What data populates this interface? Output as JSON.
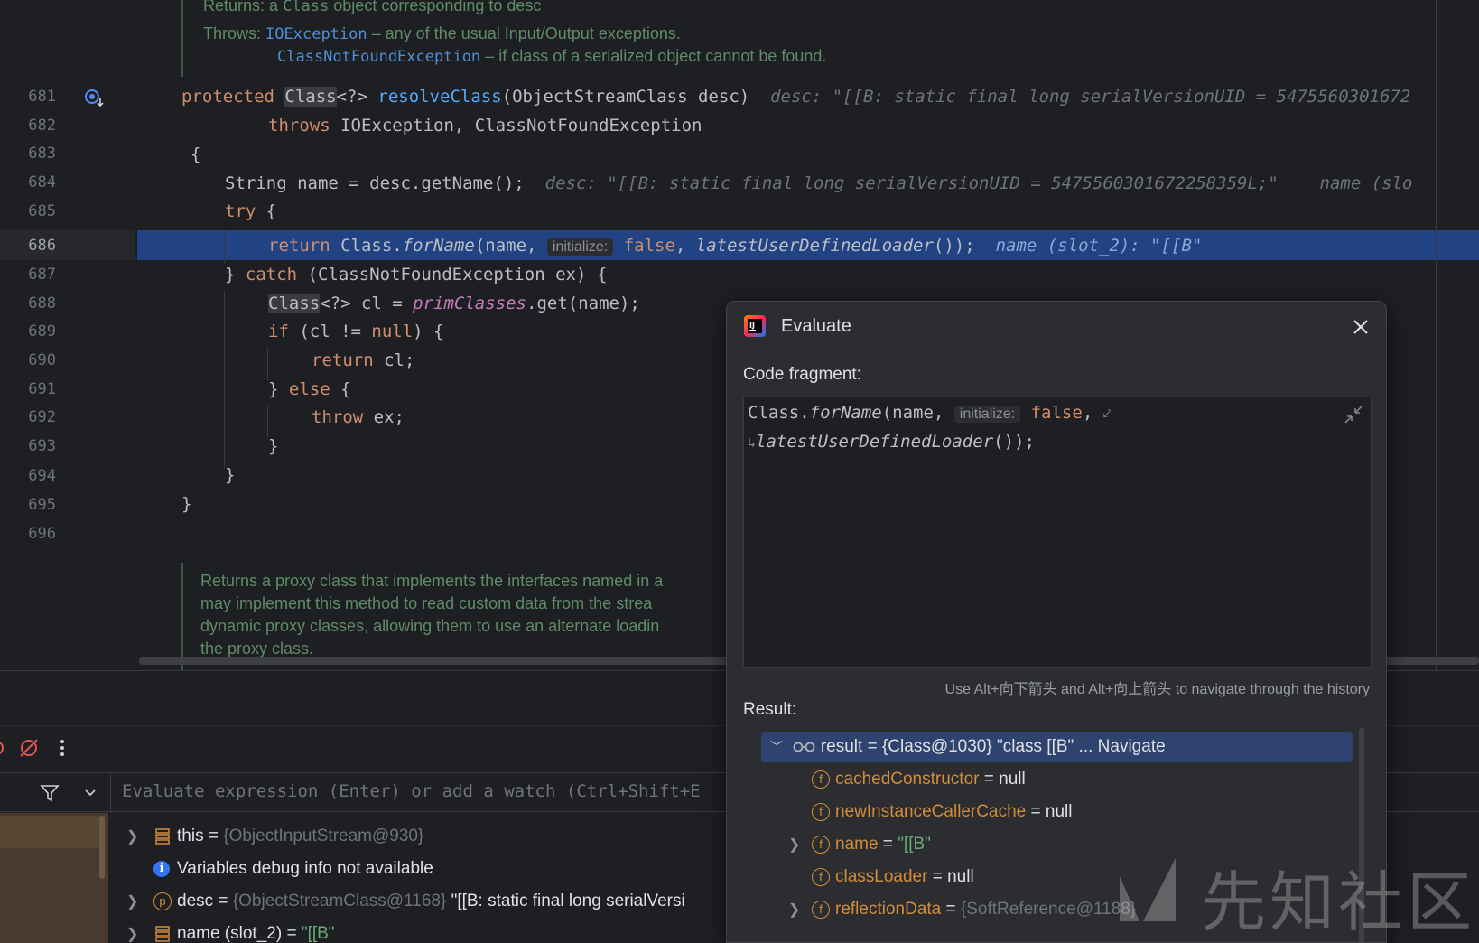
{
  "editor": {
    "doc_top": {
      "returns_label": "Returns:",
      "returns_text": "a",
      "returns_class": "Class",
      "returns_rest": "object corresponding to desc",
      "throws_label": "Throws:",
      "exc1": "IOException",
      "exc1_text": "– any of the usual Input/Output exceptions.",
      "exc2": "ClassNotFoundException",
      "exc2_text": "– if class of a serialized object cannot be found."
    },
    "line_numbers": [
      "681",
      "682",
      "683",
      "684",
      "685",
      "686",
      "687",
      "688",
      "689",
      "690",
      "691",
      "692",
      "693",
      "694",
      "695",
      "696"
    ],
    "lines": {
      "l681_kw": "protected",
      "l681_type": "Class",
      "l681_gen": "<?> ",
      "l681_fn": "resolveClass",
      "l681_rest": "(ObjectStreamClass desc)",
      "l681_hint": "desc: \"[[B: static final long serialVersionUID = 5475560301672",
      "l682_kw": "throws",
      "l682_rest": " IOException, ClassNotFoundException",
      "l683": "{",
      "l684_code": "String name = desc.getName();",
      "l684_hint": "desc: \"[[B: static final long serialVersionUID = 5475560301672258359L;\"    name (slo",
      "l685_kw": "try",
      "l685_rest": " {",
      "l686_kw": "return",
      "l686_cls": "Class.",
      "l686_fn": "forName",
      "l686_a": "(name, ",
      "l686_inlay": "initialize:",
      "l686_false": "false",
      "l686_b": ", ",
      "l686_fn2": "latestUserDefinedLoader",
      "l686_c": "());",
      "l686_hint": "name (slot_2): \"[[B\"",
      "l687_a": "} ",
      "l687_kw": "catch",
      "l687_rest": " (ClassNotFoundException ex) {",
      "l688_type": "Class",
      "l688_a": "<?> cl = ",
      "l688_field": "primClasses",
      "l688_rest": ".get(name);",
      "l689_kw": "if",
      "l689_a": " (cl != ",
      "l689_null": "null",
      "l689_rest": ") {",
      "l690_kw": "return",
      "l690_rest": " cl;",
      "l691_a": "} ",
      "l691_kw": "else",
      "l691_rest": " {",
      "l692_kw": "throw",
      "l692_rest": " ex;",
      "l693": "}",
      "l694": "}",
      "l695": "}"
    },
    "doc_bottom": [
      "Returns a proxy class that implements the interfaces named in a",
      "may implement this method to read custom data from the strea",
      "dynamic proxy classes, allowing them to use an alternate loadin",
      "the proxy class."
    ]
  },
  "debug": {
    "watch_placeholder": "Evaluate expression (Enter) or add a watch (Ctrl+Shift+E",
    "variables": [
      {
        "name": "this",
        "eq": " = ",
        "value": "{ObjectInputStream@930}"
      },
      {
        "info": "Variables debug info not available"
      },
      {
        "name": "desc",
        "eq": " = ",
        "value": "{ObjectStreamClass@1168}",
        "extra": " \"[[B: static final long serialVersi"
      },
      {
        "name": "name (slot_2)",
        "eq": " = ",
        "value": "\"[[B\""
      }
    ]
  },
  "dialog": {
    "title": "Evaluate",
    "code_label": "Code fragment:",
    "code_line1_a": "Class.",
    "code_line1_fn": "forName",
    "code_line1_b": "(name, ",
    "code_line1_inlay": "initialize:",
    "code_line1_false": "false",
    "code_line1_c": ",",
    "code_line2": "latestUserDefinedLoader",
    "code_line2_end": "());",
    "history_hint": "Use Alt+向下箭头 and Alt+向上箭头 to navigate through the history",
    "result_label": "Result:",
    "result_root": "result = {Class@1030} \"class [[B\" ... Navigate",
    "fields": [
      {
        "name": "cachedConstructor",
        "eq": " = ",
        "value": "null",
        "expandable": false
      },
      {
        "name": "newInstanceCallerCache",
        "eq": " = ",
        "value": "null",
        "expandable": false
      },
      {
        "name": "name",
        "eq": " = ",
        "value": "\"[[B\"",
        "expandable": true
      },
      {
        "name": "classLoader",
        "eq": " = ",
        "value": "null",
        "expandable": false
      },
      {
        "name": "reflectionData",
        "eq": " = ",
        "value": "{SoftReference@1188}",
        "expandable": true
      }
    ]
  },
  "watermark": "先知社区"
}
